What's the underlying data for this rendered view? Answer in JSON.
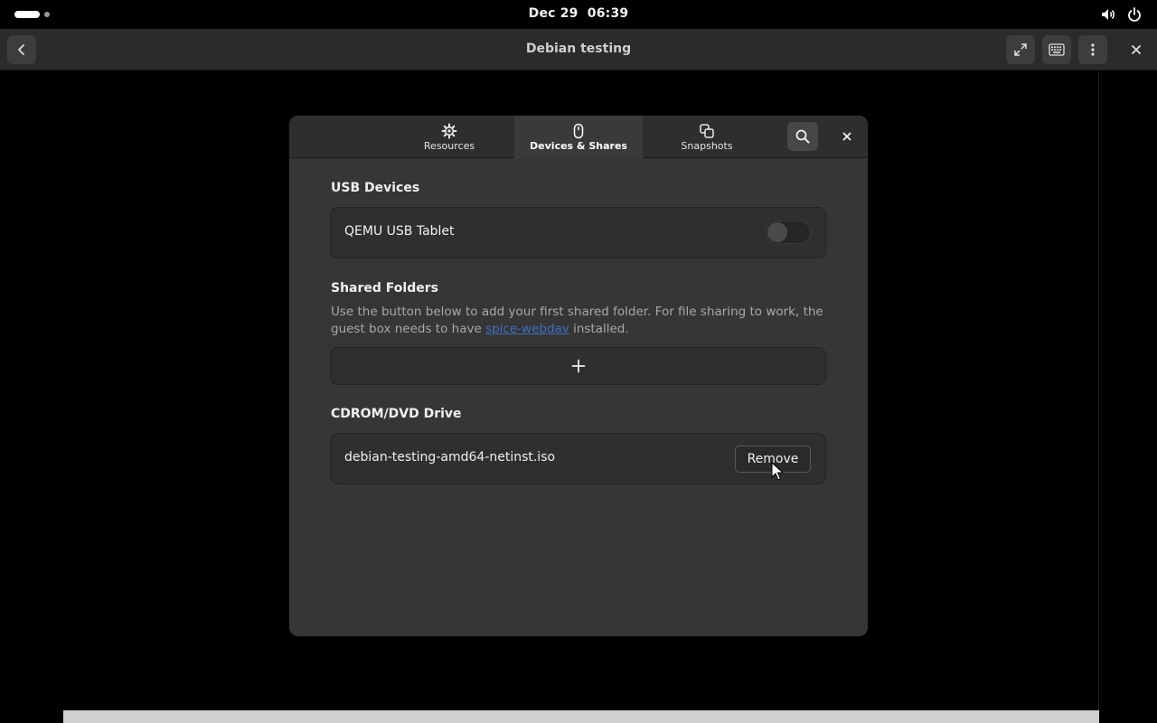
{
  "topbar": {
    "clock": "Dec 29  06:39",
    "icons": [
      "volume-icon",
      "power-icon"
    ]
  },
  "window": {
    "title": "Debian testing",
    "buttons": [
      "back-icon",
      "fullscreen-icon",
      "keyboard-icon",
      "menu-icon",
      "close-icon"
    ]
  },
  "dialog": {
    "tabs": [
      {
        "label": "Resources",
        "icon": "gear-icon"
      },
      {
        "label": "Devices & Shares",
        "icon": "mouse-icon"
      },
      {
        "label": "Snapshots",
        "icon": "snapshots-icon"
      }
    ],
    "active_tab": "Devices & Shares",
    "usb": {
      "title": "USB Devices",
      "device": "QEMU USB Tablet",
      "enabled": false
    },
    "shared": {
      "title": "Shared Folders",
      "desc_before": "Use the button below to add your first shared folder. For file sharing to work, the guest box needs to have ",
      "link": "spice-webdav",
      "desc_after": " installed."
    },
    "cdrom": {
      "title": "CDROM/DVD Drive",
      "file": "debian-testing-amd64-netinst.iso",
      "remove_label": "Remove"
    }
  },
  "colors": {
    "accent_link": "#3f6fbf",
    "dialog_bg": "#363636",
    "card_bg": "#2f2f2f"
  }
}
